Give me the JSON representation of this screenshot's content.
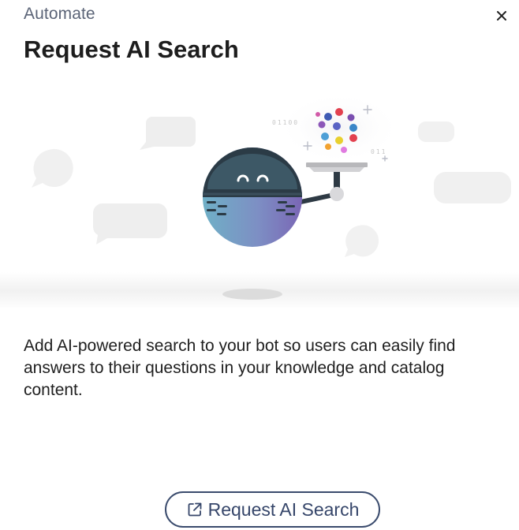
{
  "header": {
    "eyebrow": "Automate",
    "title": "Request AI Search",
    "close_icon": "close-icon"
  },
  "illustration": {
    "subject": "bot-mascot-icon",
    "code_text_left": "01100",
    "code_text_right": "011"
  },
  "body": {
    "description": "Add AI-powered search to your bot so users can easily find answers to their questions in your knowledge and catalog content."
  },
  "cta": {
    "label": "Request AI Search",
    "icon": "external-link-icon"
  },
  "colors": {
    "button_border": "#3a4b6d",
    "button_text": "#36466a",
    "eyebrow_text": "#5b6477"
  }
}
